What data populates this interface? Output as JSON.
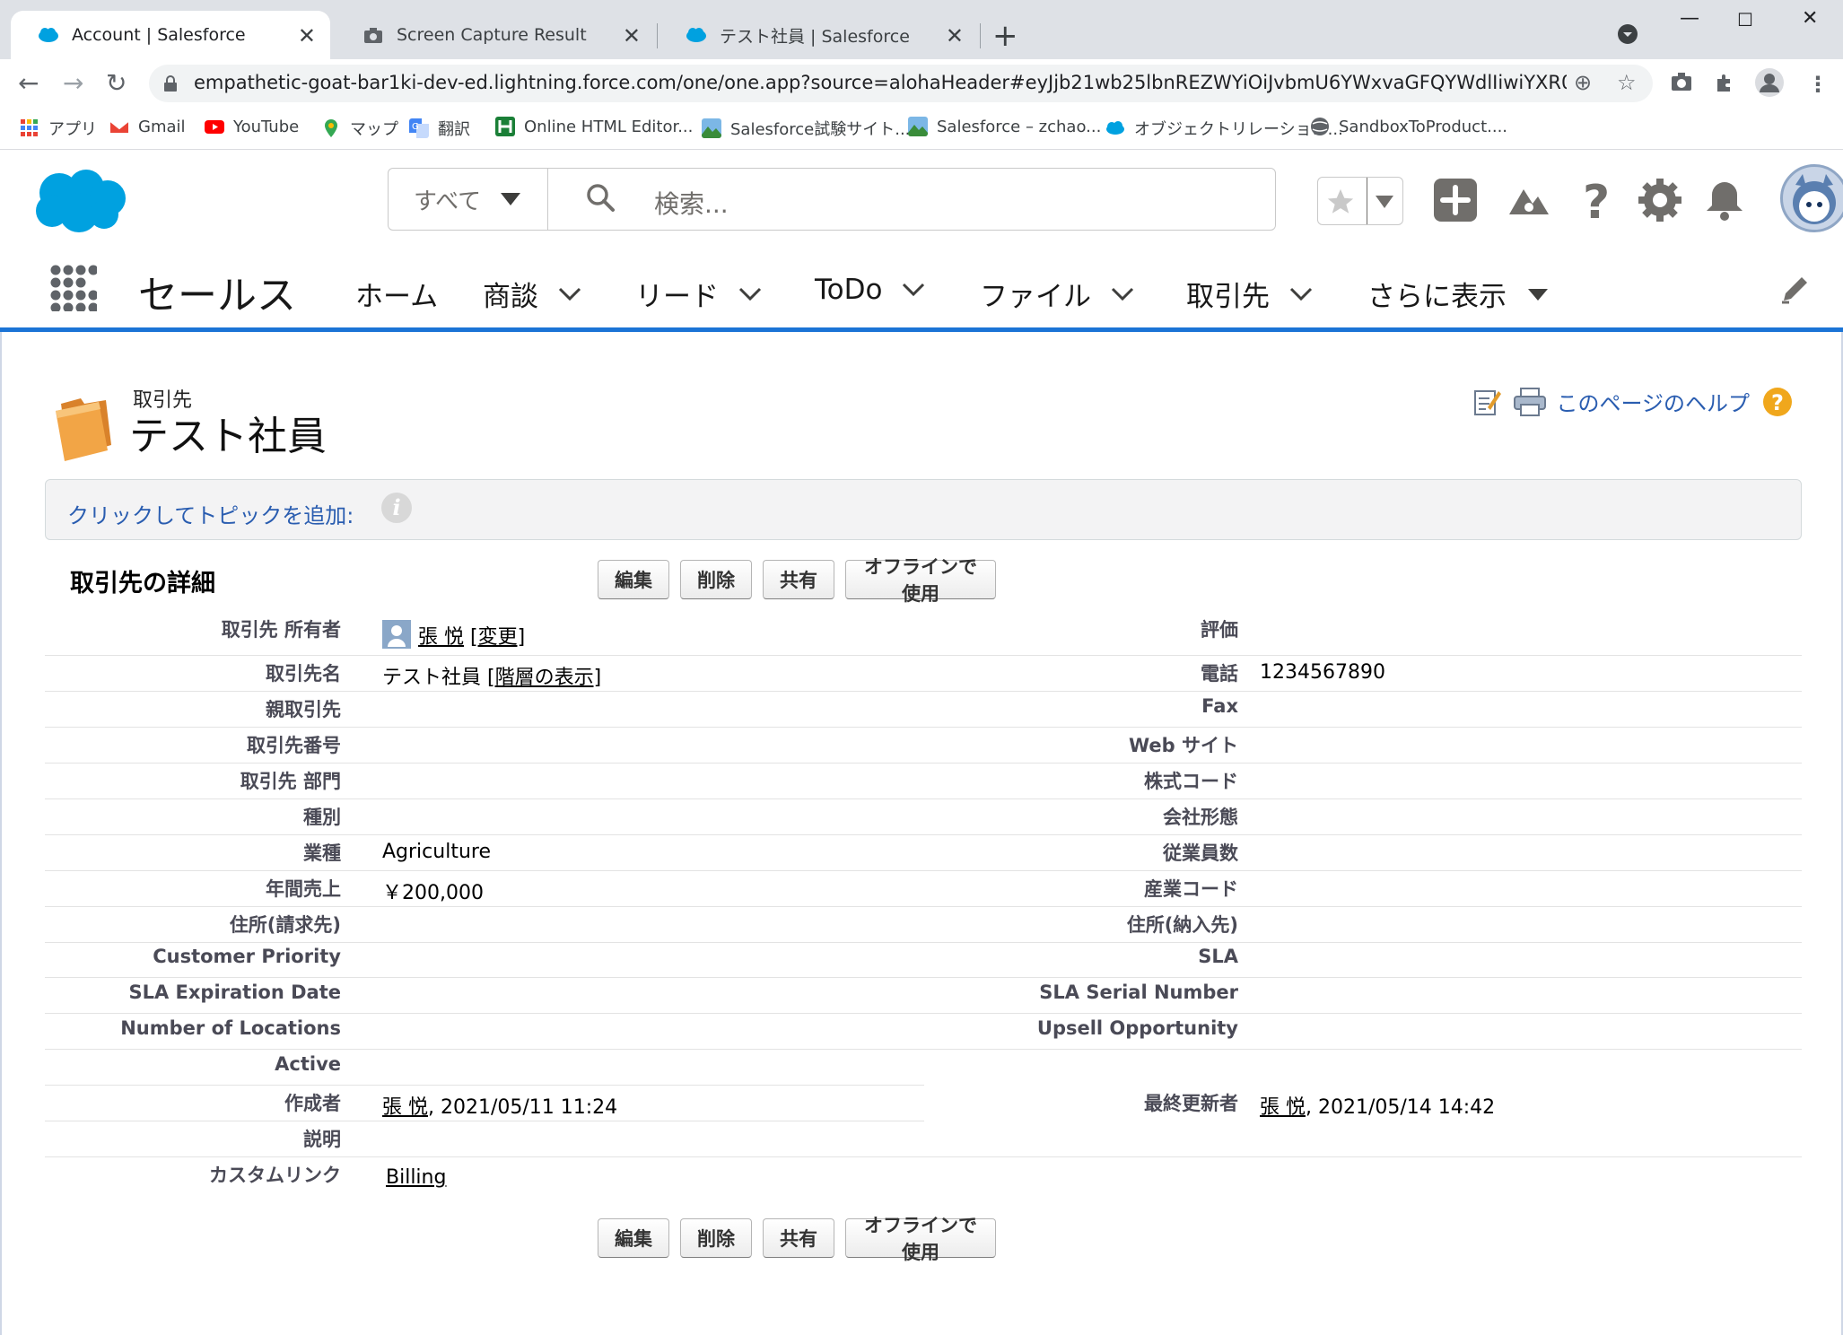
{
  "browser": {
    "tabs": [
      {
        "title": "Account | Salesforce",
        "active": true,
        "favicon": "salesforce-cloud-icon"
      },
      {
        "title": "Screen Capture Result",
        "active": false,
        "favicon": "camera-icon"
      },
      {
        "title": "テスト社員 | Salesforce",
        "active": false,
        "favicon": "salesforce-cloud-icon"
      }
    ],
    "url": "empathetic-goat-bar1ki-dev-ed.lightning.force.com/one/one.app?source=alohaHeader#eyJjb21wb25lbnREZWYiOiJvbmU6YWxvaGFQYWdlIiwiYXR0cmlidXRlcyI6ey...",
    "bookmarks": [
      {
        "label": "アプリ",
        "icon": "apps-grid-icon"
      },
      {
        "label": "Gmail",
        "icon": "gmail-icon"
      },
      {
        "label": "YouTube",
        "icon": "youtube-icon"
      },
      {
        "label": "マップ",
        "icon": "maps-pin-icon"
      },
      {
        "label": "翻訳",
        "icon": "translate-icon"
      },
      {
        "label": "Online HTML Editor...",
        "icon": "html-editor-icon"
      },
      {
        "label": "Salesforce試験サイト...",
        "icon": "landscape-icon"
      },
      {
        "label": "Salesforce – zchao...",
        "icon": "landscape-icon"
      },
      {
        "label": "オブジェクトリレーション...",
        "icon": "salesforce-cloud-icon"
      },
      {
        "label": "SandboxToProduct....",
        "icon": "globe-icon"
      }
    ]
  },
  "header": {
    "search_scope": "すべて",
    "search_placeholder": "検索..."
  },
  "nav": {
    "app_name": "セールス",
    "items": [
      {
        "label": "ホーム",
        "has_menu": false
      },
      {
        "label": "商談",
        "has_menu": true
      },
      {
        "label": "リード",
        "has_menu": true
      },
      {
        "label": "ToDo",
        "has_menu": true
      },
      {
        "label": "ファイル",
        "has_menu": true
      },
      {
        "label": "取引先",
        "has_menu": true
      },
      {
        "label": "さらに表示",
        "has_menu": true
      }
    ]
  },
  "record": {
    "object_type": "取引先",
    "name": "テスト社員",
    "help_link": "このページのヘルプ",
    "topic_link": "クリックしてトピックを追加:",
    "detail_title": "取引先の詳細",
    "buttons": [
      "編集",
      "削除",
      "共有",
      "オフラインで使用"
    ]
  },
  "fields": {
    "owner_label": "取引先 所有者",
    "owner_value": "張 悦",
    "owner_change": "[変更]",
    "rating_label": "評価",
    "name_label": "取引先名",
    "name_value": "テスト社員",
    "hierarchy_link": "[階層の表示]",
    "phone_label": "電話",
    "phone_value": "1234567890",
    "parent_label": "親取引先",
    "fax_label": "Fax",
    "number_label": "取引先番号",
    "website_label": "Web サイト",
    "site_label": "取引先 部門",
    "ticker_label": "株式コード",
    "type_label": "種別",
    "ownership_label": "会社形態",
    "industry_label": "業種",
    "industry_value": "Agriculture",
    "employees_label": "従業員数",
    "revenue_label": "年間売上",
    "revenue_value": "￥200,000",
    "sic_label": "産業コード",
    "billing_label": "住所(請求先)",
    "shipping_label": "住所(納入先)",
    "priority_label": "Customer Priority",
    "sla_label": "SLA",
    "sla_exp_label": "SLA Expiration Date",
    "sla_serial_label": "SLA Serial Number",
    "locations_label": "Number of Locations",
    "upsell_label": "Upsell Opportunity",
    "active_label": "Active",
    "created_label": "作成者",
    "created_user": "張 悦",
    "created_date": ", 2021/05/11 11:24",
    "modified_label": "最終更新者",
    "modified_user": "張 悦",
    "modified_date": ", 2021/05/14 14:42",
    "description_label": "説明",
    "custom_links_label": "カスタムリンク",
    "custom_link": "Billing"
  },
  "colors": {
    "brand_blue": "#1b74d6",
    "link_blue": "#2a5db0",
    "salesforce_cloud": "#00a1e0",
    "header_icon_gray": "#706e6b"
  }
}
